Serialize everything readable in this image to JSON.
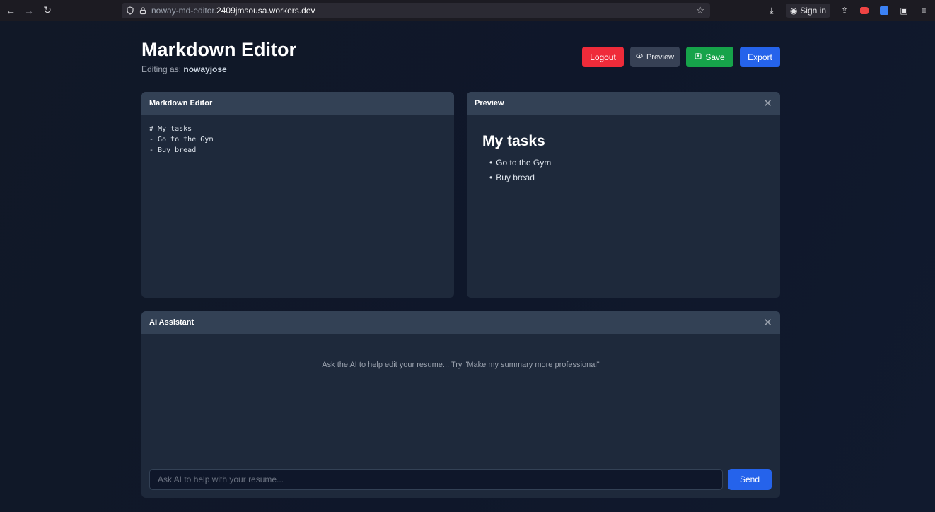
{
  "browser": {
    "url_host": "noway-md-editor.",
    "url_domain": "2409jmsousa.workers.dev",
    "sign_in_label": "Sign in",
    "icons": [
      "back-icon",
      "forward-icon",
      "reload-icon",
      "shield-icon",
      "lock-icon",
      "star-icon",
      "download-icon",
      "account-icon",
      "share-icon",
      "extension-icon",
      "menu-icon"
    ]
  },
  "header": {
    "title": "Markdown Editor",
    "editing_as_label": "Editing as: ",
    "username": "nowayjose"
  },
  "toolbar": {
    "logout_label": "Logout",
    "preview_label": "Preview",
    "save_label": "Save",
    "export_label": "Export"
  },
  "editor": {
    "title": "Markdown Editor",
    "content": "# My tasks\n- Go to the Gym\n- Buy bread"
  },
  "preview": {
    "title": "Preview",
    "heading": "My tasks",
    "items": [
      "Go to the Gym",
      "Buy bread"
    ]
  },
  "ai": {
    "title": "AI Assistant",
    "empty_message": "Ask the AI to help edit your resume... Try \"Make my summary more professional\"",
    "input_value": "",
    "input_placeholder": "Ask AI to help with your resume...",
    "send_label": "Send"
  },
  "colors": {
    "logout": "#ef2b3a",
    "preview": "#374155",
    "save": "#16a34a",
    "export": "#2563eb",
    "panel": "#1e293b",
    "panel_header": "#334155"
  }
}
